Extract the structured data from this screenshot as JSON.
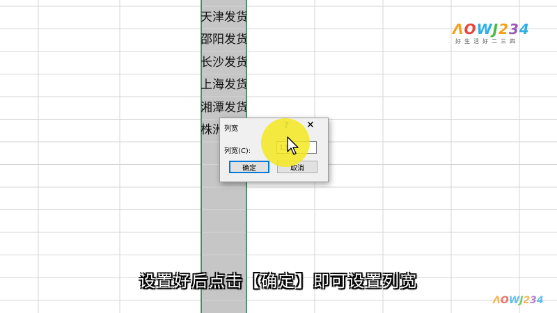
{
  "sheet": {
    "visible_cells": [
      "天津发货",
      "邵阳发货",
      "长沙发货",
      "上海发货",
      "湘潭发货",
      "株洲"
    ]
  },
  "dialog": {
    "title": "列宽",
    "help_label": "?",
    "close_label": "✕",
    "field_label": "列宽(C):",
    "field_value": "13",
    "ok_label": "确定",
    "cancel_label": "取消"
  },
  "caption": "设置好后点击【确定】即可设置列宽",
  "logo": {
    "top_text": "ɅOWJ234",
    "sub_text": "好生活好二三四",
    "bottom_text": "ɅOWJ234"
  },
  "colors": {
    "grid_line": "#d4d4d4",
    "selected_column": "#c6c6c6",
    "selection_border": "#217346",
    "highlight": "#f5e81e",
    "logo_colors": [
      "#f6a01a",
      "#e8443a",
      "#2db0e6",
      "#4cb848",
      "#f6a01a",
      "#9b59b6",
      "#2db0e6"
    ]
  }
}
